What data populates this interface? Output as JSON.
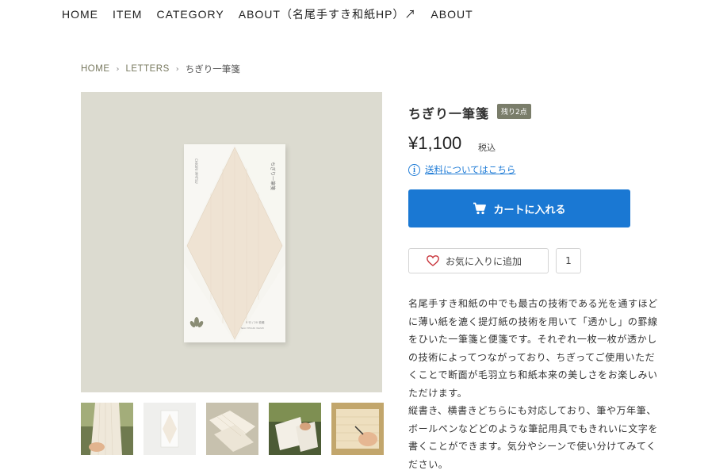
{
  "nav": {
    "items": [
      "HOME",
      "ITEM",
      "CATEGORY",
      "ABOUT（名尾手すき和紙HP）↗",
      "ABOUT"
    ]
  },
  "breadcrumb": {
    "home": "HOME",
    "category": "LETTERS",
    "current": "ちぎり一筆箋"
  },
  "product": {
    "title": "ちぎり一筆箋",
    "stock_badge": "残り2点",
    "price": "¥1,100",
    "tax_label": "税込",
    "shipping_link": "送料についてはこちら",
    "cart_button": "カートに入れる",
    "favorite_button": "お気に入りに追加",
    "favorite_count": "1",
    "description": [
      "名尾手すき和紙の中でも最古の技術である光を通すほどに薄い紙を漉く提灯紙の技術を用いて「透かし」の罫線をひいた一筆箋と便箋です。それぞれ一枚一枚が透かしの技術によってつながっており、ちぎってご使用いただくことで断面が毛羽立ち和紙本来の美しさをお楽しみいただけます。",
      "縦書き、横書きどちらにも対応しており、筆や万年筆、ボールペンなどどのような筆記用具でもきれいに文字を書くことができます。気分やシーンで使い分けてみてください。"
    ]
  },
  "image": {
    "package_text_vertical": "ちぎり一筆箋",
    "package_side_text": "CHIGIRI IPPITSU",
    "package_count": "5 行 / 20 枚綴",
    "package_brand": "NAO TESUKI WASHI"
  },
  "thumbnails": [
    "thumb-1",
    "thumb-2",
    "thumb-3",
    "thumb-4",
    "thumb-5"
  ],
  "colors": {
    "accent": "#1a78d3",
    "badge": "#7a7d6a",
    "breadcrumb": "#77785e"
  }
}
